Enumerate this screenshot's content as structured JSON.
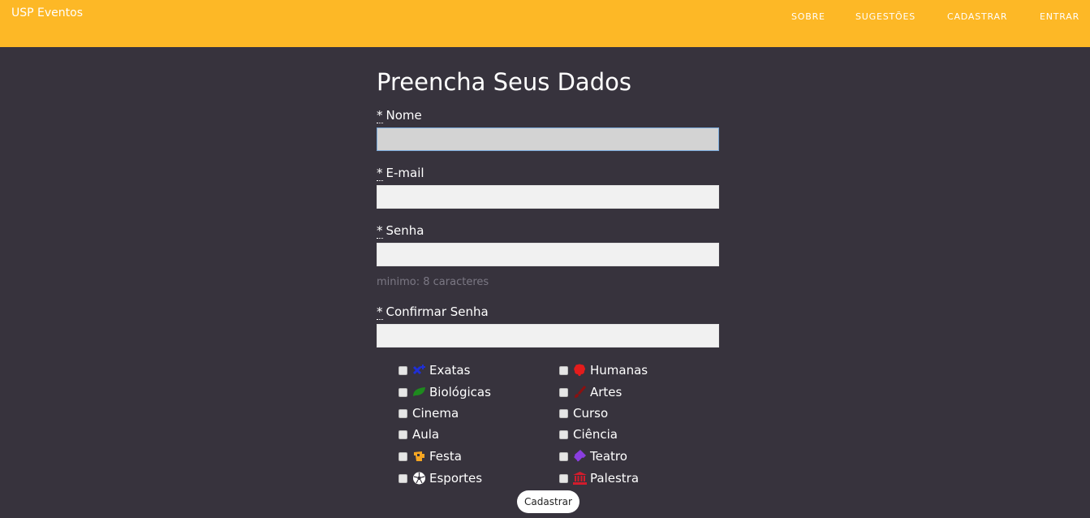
{
  "navbar": {
    "brand": "USP Eventos",
    "links": [
      "SOBRE",
      "SUGESTÕES",
      "CADASTRAR",
      "ENTRAR"
    ]
  },
  "form": {
    "title": "Preencha Seus Dados",
    "required_mark": "*",
    "fields": {
      "nome": {
        "label": "Nome",
        "value": ""
      },
      "email": {
        "label": "E-mail",
        "value": ""
      },
      "senha": {
        "label": "Senha",
        "value": "",
        "hint": "minimo: 8 caracteres"
      },
      "confirmar": {
        "label": "Confirmar Senha",
        "value": ""
      }
    },
    "categories": [
      {
        "label": "Exatas",
        "icon": "math-icon",
        "color": "#1f2fd6",
        "checked": false
      },
      {
        "label": "Humanas",
        "icon": "brain-icon",
        "color": "#e31c1c",
        "checked": false
      },
      {
        "label": "Biológicas",
        "icon": "leaf-icon",
        "color": "#1e8a1e",
        "checked": false
      },
      {
        "label": "Artes",
        "icon": "brush-icon",
        "color": "#8b1010",
        "checked": false
      },
      {
        "label": "Cinema",
        "icon": "",
        "checked": false
      },
      {
        "label": "Curso",
        "icon": "",
        "checked": false
      },
      {
        "label": "Aula",
        "icon": "",
        "checked": false
      },
      {
        "label": "Ciência",
        "icon": "",
        "checked": false
      },
      {
        "label": "Festa",
        "icon": "party-icon",
        "color": "#f5a623",
        "checked": false
      },
      {
        "label": "Teatro",
        "icon": "ticket-icon",
        "color": "#8a3ee0",
        "checked": false
      },
      {
        "label": "Esportes",
        "icon": "soccer-ball-icon",
        "color": "#ffffff",
        "checked": false
      },
      {
        "label": "Palestra",
        "icon": "building-icon",
        "color": "#d31c2c",
        "checked": false
      }
    ],
    "submit_label": "Cadastrar"
  },
  "colors": {
    "navbar": "#fdb826",
    "background": "#37333d",
    "hint": "#7b7884"
  }
}
